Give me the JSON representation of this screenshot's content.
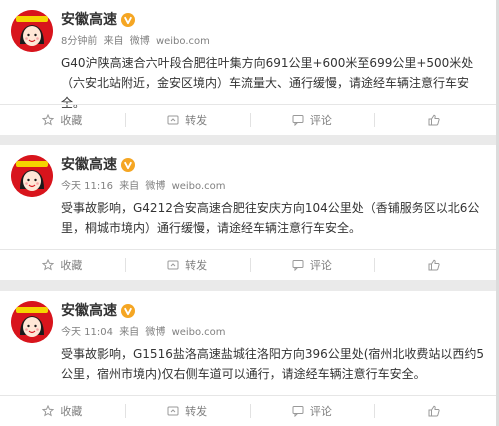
{
  "colors": {
    "background": "#eaeaea",
    "card": "#ffffff",
    "name_text": "#333333",
    "meta_text": "#808080",
    "avatar_red": "#d8141c",
    "verified_orange": "#f5a623"
  },
  "posts": [
    {
      "author": "安徽高速",
      "verified_icon": "verified-v-icon",
      "time": "8分钟前",
      "source_prefix": "来自",
      "source": "微博",
      "source_url": "weibo.com",
      "text": "G40沪陕高速合六叶段合肥往叶集方向691公里+600米至699公里+500米处（六安北站附近，金安区境内）车流量大、通行缓慢，请途经车辆注意行车安全。",
      "actions": [
        {
          "icon": "star-icon",
          "label": "收藏"
        },
        {
          "icon": "share-icon",
          "label": "转发"
        },
        {
          "icon": "comment-icon",
          "label": "评论"
        },
        {
          "icon": "thumbs-up-icon",
          "label": ""
        }
      ]
    },
    {
      "author": "安徽高速",
      "verified_icon": "verified-v-icon",
      "time": "今天 11:16",
      "source_prefix": "来自",
      "source": "微博",
      "source_url": "weibo.com",
      "text": "受事故影响，G4212合安高速合肥往安庆方向104公里处（香铺服务区以北6公里，桐城市境内）通行缓慢，请途经车辆注意行车安全。",
      "actions": [
        {
          "icon": "star-icon",
          "label": "收藏"
        },
        {
          "icon": "share-icon",
          "label": "转发"
        },
        {
          "icon": "comment-icon",
          "label": "评论"
        },
        {
          "icon": "thumbs-up-icon",
          "label": ""
        }
      ]
    },
    {
      "author": "安徽高速",
      "verified_icon": "verified-v-icon",
      "time": "今天 11:04",
      "source_prefix": "来自",
      "source": "微博",
      "source_url": "weibo.com",
      "text": "受事故影响，G1516盐洛高速盐城往洛阳方向396公里处(宿州北收费站以西约5公里，宿州市境内)仅右侧车道可以通行，请途经车辆注意行车安全。",
      "actions": [
        {
          "icon": "star-icon",
          "label": "收藏"
        },
        {
          "icon": "share-icon",
          "label": "转发"
        },
        {
          "icon": "comment-icon",
          "label": "评论"
        },
        {
          "icon": "thumbs-up-icon",
          "label": ""
        }
      ]
    }
  ]
}
